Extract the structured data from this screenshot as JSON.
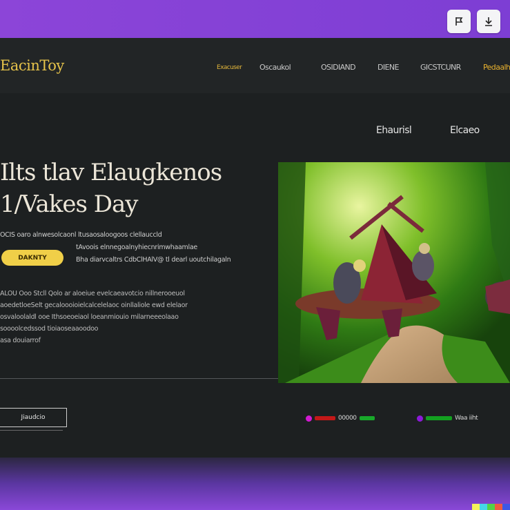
{
  "toolbar": {
    "flag_icon": "flag-icon",
    "download_icon": "download-icon"
  },
  "header": {
    "logo": "EacinToy",
    "nav": [
      {
        "label": "Exacuser"
      },
      {
        "label": "Oscaukol"
      },
      {
        "label": "OSIDIAND"
      },
      {
        "label": "DIENE"
      },
      {
        "label": "GICSTCUNR"
      },
      {
        "label": "Pedaalh"
      }
    ]
  },
  "subnav": {
    "link1": "Ehaurisl",
    "link2": "Elcaeo"
  },
  "hero": {
    "title_line1": "Ilts tlav Elaugkenos",
    "title_line2": "1/Vakes Day",
    "lead1": "OCIS oaro alnwesolcaonl ltusaosaloogoos clellauccld",
    "lead2": "tAvoois elnnegoalnyhiecnrimwhaamlae",
    "lead3": "Bha diarvcaltrs CdbClHAlV@ tl dearl uoutchilagaln",
    "pill_label": "DAKNTY",
    "para": [
      "ALOU Ooo  Stcll Qolo ar aloeiue evelcaeavotcio nillnerooeuol",
      "aoedetloeSelt gecaloooioielcalcelelaoc  oinllaliole ewd elelaor",
      "osvaloolaldl ooe Ithsoeoeiaol loeanmiouio milarneeeolaao",
      "soooolcedssod  tioiaoseaaoodoo",
      "asa douiarrof"
    ],
    "cta_label": "Jiaudcio"
  },
  "status": {
    "group1_text": "00000",
    "group2_text": "Waa  iiht"
  },
  "colors": {
    "accent": "#e6c34a",
    "pill": "#f0cf48",
    "background": "#1d2021",
    "frame": "#8a44d6"
  }
}
